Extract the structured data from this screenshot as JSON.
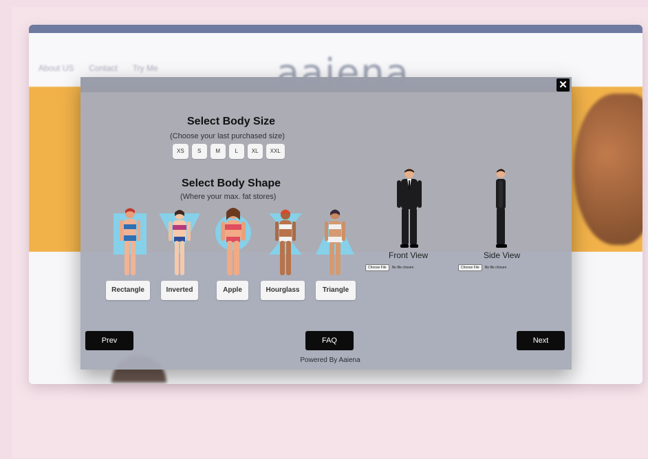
{
  "background_site": {
    "nav": [
      "About US",
      "Contact",
      "Try Me"
    ],
    "logo": "aaiena"
  },
  "modal": {
    "close_label": "✕",
    "body_size": {
      "title": "Select Body Size",
      "subtitle": "(Choose your last purchased size)",
      "sizes": [
        "XS",
        "S",
        "M",
        "L",
        "XL",
        "XXL"
      ]
    },
    "body_shape": {
      "title": "Select Body Shape",
      "subtitle": "(Where your max. fat stores)",
      "shapes": [
        "Rectangle",
        "Inverted",
        "Apple",
        "Hourglass",
        "Triangle"
      ]
    },
    "front_view": {
      "label": "Front View",
      "choose_file": "Choose File",
      "file_status": "No file chosen"
    },
    "side_view": {
      "label": "Side View",
      "choose_file": "Choose File",
      "file_status": "No file chosen"
    },
    "buttons": {
      "prev": "Prev",
      "faq": "FAQ",
      "next": "Next"
    },
    "powered_by": "Powered By Aaiena"
  },
  "colors": {
    "page_bg": "#f3dde6",
    "modal_bg": "#a8acb8",
    "button_dark": "#0c0c0c",
    "shape_highlight": "#7fd6f2",
    "hero_orange": "#f2b24a"
  }
}
